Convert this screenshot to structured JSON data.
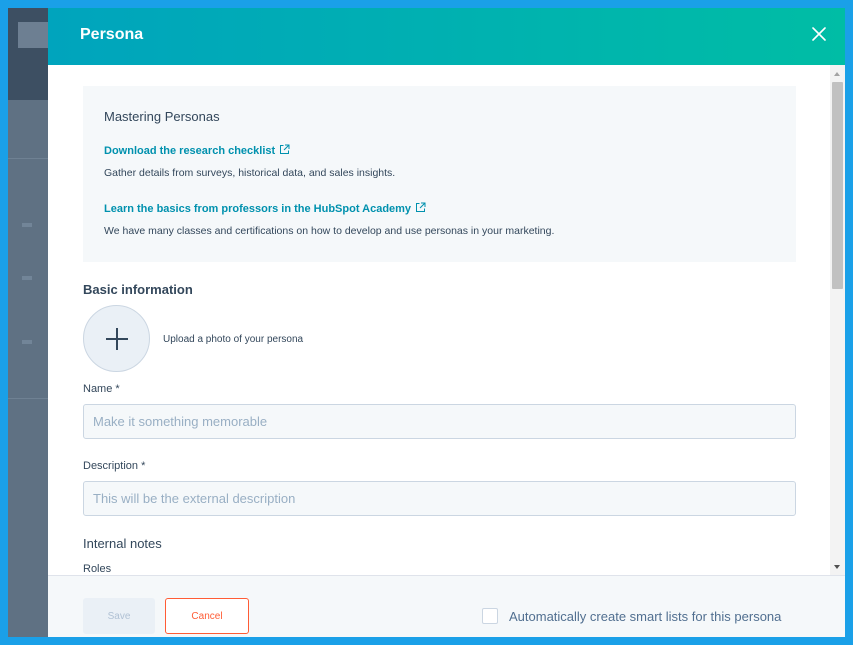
{
  "modal": {
    "title": "Persona",
    "close_icon": "close-icon"
  },
  "info_box": {
    "title": "Mastering Personas",
    "links": [
      {
        "label": "Download the research checklist",
        "icon": "external-link-icon",
        "description": "Gather details from surveys, historical data, and sales insights."
      },
      {
        "label": "Learn the basics from professors in the HubSpot Academy",
        "icon": "external-link-icon",
        "description": "We have many classes and certifications on how to develop and use personas in your marketing."
      }
    ]
  },
  "basic_info": {
    "title": "Basic information",
    "upload_icon": "plus-icon",
    "upload_label": "Upload a photo of your persona",
    "name_label": "Name *",
    "name_placeholder": "Make it something memorable",
    "name_value": "",
    "description_label": "Description *",
    "description_placeholder": "This will be the external description",
    "description_value": ""
  },
  "internal_notes": {
    "title": "Internal notes",
    "roles_label": "Roles"
  },
  "footer": {
    "save_label": "Save",
    "cancel_label": "Cancel",
    "auto_lists_label": "Automatically create smart lists for this persona",
    "auto_lists_checked": false
  },
  "colors": {
    "header_gradient_start": "#00a4bd",
    "header_gradient_end": "#00bda5",
    "link": "#0091ae",
    "cancel_accent": "#ff5c35",
    "outer_frame": "#1aa0e8"
  }
}
